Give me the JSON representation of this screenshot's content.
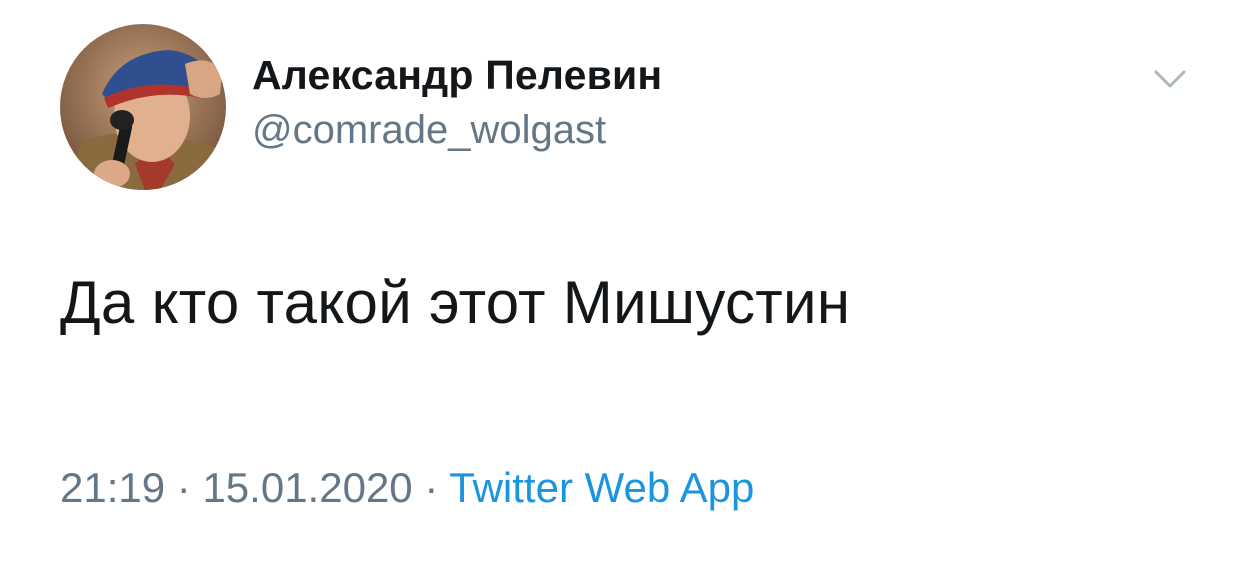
{
  "tweet": {
    "author_name": "Александр Пелевин",
    "author_handle": "@comrade_wolgast",
    "text": "Да кто такой этот Мишустин",
    "time": "21:19",
    "separator": "·",
    "date": "15.01.2020",
    "source": "Twitter Web App"
  },
  "icons": {
    "menu": "chevron-down-icon"
  },
  "colors": {
    "text_primary": "#14171a",
    "text_secondary": "#657786",
    "link": "#1b95e0",
    "caret": "#aab8c2"
  }
}
